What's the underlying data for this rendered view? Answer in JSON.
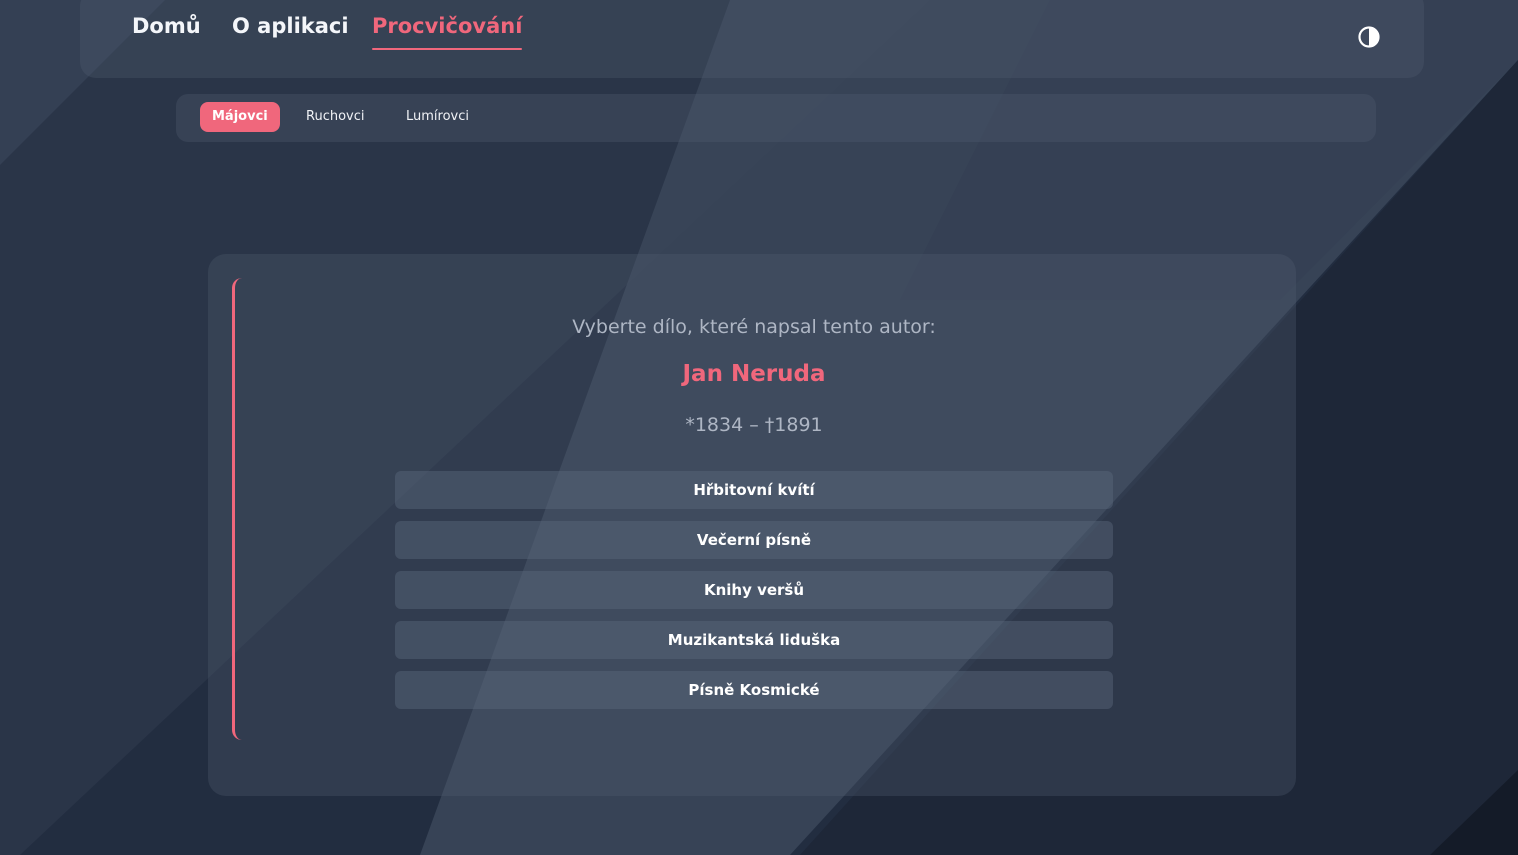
{
  "nav": {
    "links": [
      {
        "label": "Domů"
      },
      {
        "label": "O aplikaci"
      },
      {
        "label": "Procvičování"
      }
    ],
    "active_index": 2,
    "theme_toggle_icon": "contrast-icon"
  },
  "subnav": {
    "tabs": [
      {
        "label": "Májovci"
      },
      {
        "label": "Ruchovci"
      },
      {
        "label": "Lumírovci"
      }
    ],
    "active_index": 0
  },
  "quiz": {
    "prompt": "Vyberte dílo, které napsal tento autor:",
    "author": "Jan Neruda",
    "dates": "*1834 – †1891",
    "options": [
      {
        "label": "Hřbitovní kvítí"
      },
      {
        "label": "Večerní písně"
      },
      {
        "label": "Knihy veršů"
      },
      {
        "label": "Muzikantská liduška"
      },
      {
        "label": "Písně Kosmické"
      }
    ]
  },
  "colors": {
    "accent": "#f0677c",
    "background": "#243044",
    "text_muted": "#aeb6c4"
  }
}
